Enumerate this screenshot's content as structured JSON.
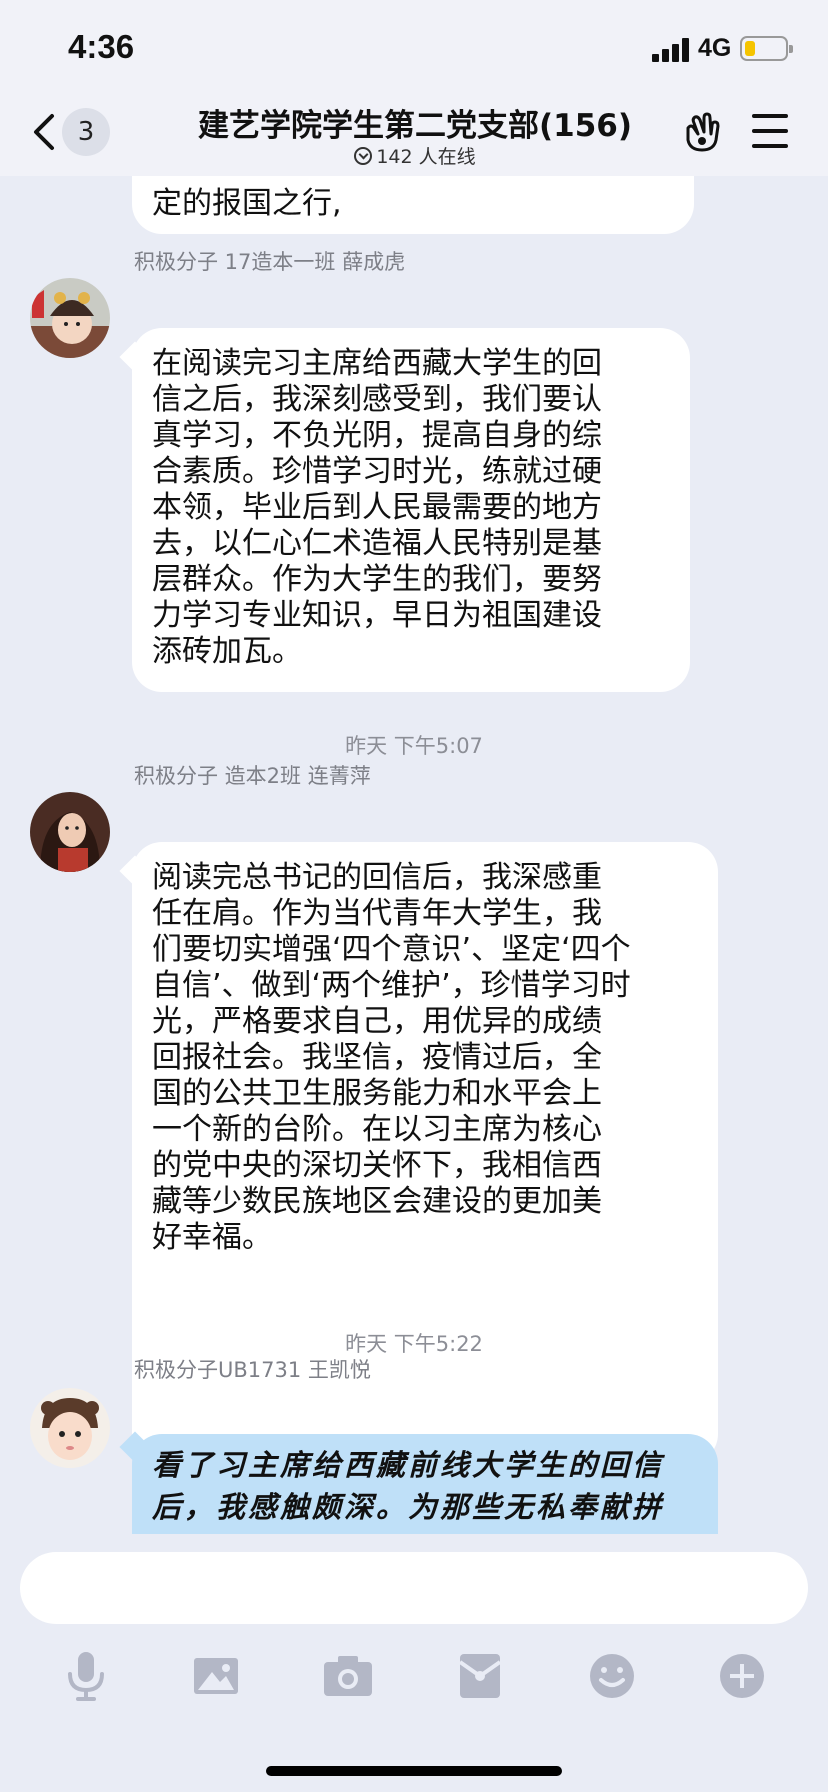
{
  "status_bar": {
    "time": "4:36",
    "network": "4G",
    "battery_level": 0.25,
    "battery_color": "#f5c400"
  },
  "nav": {
    "unread_count": "3",
    "title": "建艺学院学生第二党支部(156)",
    "online": "142 人在线"
  },
  "messages": [
    {
      "partial": true,
      "lines": [
        "定的报国之行,"
      ]
    },
    {
      "sender": "积极分子 17造本一班 薛成虎",
      "lines": [
        "在阅读完习主席给西藏大学生的回",
        "信之后，我深刻感受到，我们要认",
        "真学习，不负光阴，提高自身的综",
        "合素质。珍惜学习时光，练就过硬",
        "本领，毕业后到人民最需要的地方",
        "去，以仁心仁术造福人民特别是基",
        "层群众。作为大学生的我们，要努",
        "力学习专业知识，早日为祖国建设",
        "添砖加瓦。"
      ]
    },
    {
      "timestamp": "昨天 下午5:07"
    },
    {
      "sender": "积极分子 造本2班 连菁萍",
      "lines": [
        "阅读完总书记的回信后，我深感重",
        "任在肩。作为当代青年大学生，我",
        "们要切实增强‘四个意识’、坚定‘四个",
        "自信’、做到‘两个维护’，珍惜学习时",
        "光，严格要求自己，用优异的成绩",
        "回报社会。我坚信，疫情过后，全",
        "国的公共卫生服务能力和水平会上",
        "一个新的台阶。在以习主席为核心",
        "的党中央的深切关怀下，我相信西",
        "藏等少数民族地区会建设的更加美",
        "好幸福。"
      ]
    },
    {
      "timestamp": "昨天 下午5:22"
    },
    {
      "sender": "积极分子UB1731  王凯悦",
      "bubble_color": "#bfe0f8",
      "lines": [
        "看了习主席给西藏前线大学生的回信",
        "后，我感触颇深。为那些无私奉献拼"
      ]
    }
  ],
  "toolbar": [
    "microphone-icon",
    "image-icon",
    "camera-icon",
    "red-packet-icon",
    "emoji-icon",
    "plus-icon"
  ],
  "colors": {
    "background": "#e9ecf5",
    "bubble": "#ffffff",
    "blue_bubble": "#bfe0f8",
    "meta_text": "#7d7f87"
  }
}
